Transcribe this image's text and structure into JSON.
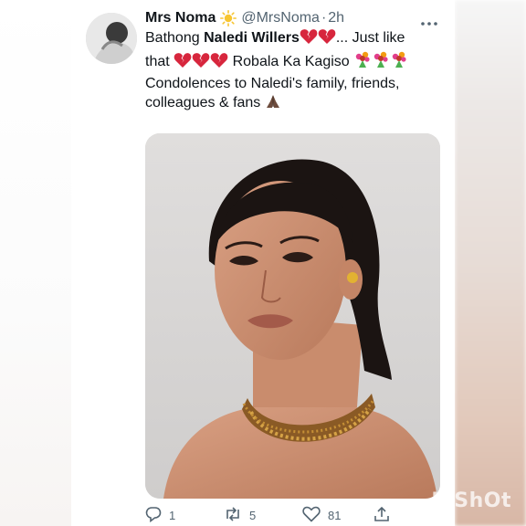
{
  "tweet": {
    "display_name": "Mrs Noma",
    "handle": "@MrsNoma",
    "separator": "·",
    "time": "2h",
    "text": {
      "l1_pre": "Bathong ",
      "l1_bold": "Naledi Willers",
      "l1_post": "... Just like",
      "l2_pre": "that",
      "l2_post": "Robala Ka Kagiso",
      "l3": "Condolences to Naledi's family, friends,",
      "l4": "colleagues & fans"
    },
    "media_icon": "portrait-photo"
  },
  "actions": {
    "reply_count": "1",
    "retweet_count": "5",
    "like_count": "81"
  },
  "icons": {
    "verified": "sun-emoji",
    "hearts": "broken-heart-emoji",
    "flowers": "bouquet-emoji",
    "hands": "folded-hands-emoji"
  },
  "watermark": "InShOt",
  "colors": {
    "text": "#0f1419",
    "muted": "#536471",
    "heart": "#d7263d"
  }
}
